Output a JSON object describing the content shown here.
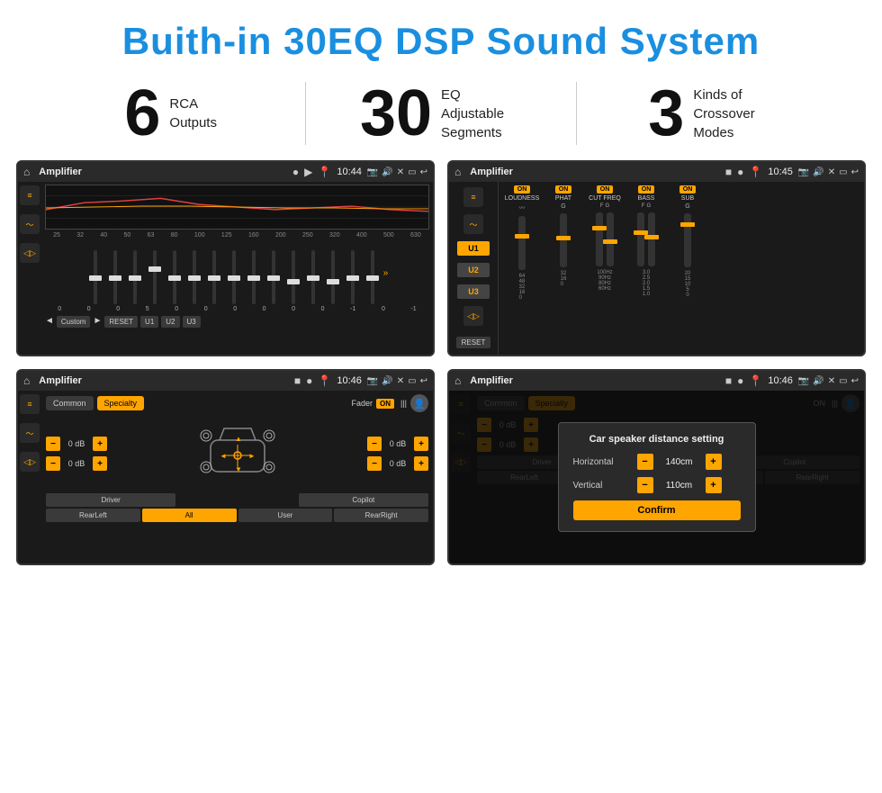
{
  "header": {
    "title": "Buith-in 30EQ DSP Sound System"
  },
  "stats": [
    {
      "number": "6",
      "text": "RCA\nOutputs"
    },
    {
      "number": "30",
      "text": "EQ Adjustable\nSegments"
    },
    {
      "number": "3",
      "text": "Kinds of\nCrossover Modes"
    }
  ],
  "screens": [
    {
      "id": "eq-screen",
      "title": "Amplifier",
      "time": "10:44",
      "type": "eq"
    },
    {
      "id": "amp2-screen",
      "title": "Amplifier",
      "time": "10:45",
      "type": "amp2"
    },
    {
      "id": "fader-screen",
      "title": "Amplifier",
      "time": "10:46",
      "type": "fader"
    },
    {
      "id": "dialog-screen",
      "title": "Amplifier",
      "time": "10:46",
      "type": "dialog"
    }
  ],
  "eq": {
    "freqs": [
      "25",
      "32",
      "40",
      "50",
      "63",
      "80",
      "100",
      "125",
      "160",
      "200",
      "250",
      "320",
      "400",
      "500",
      "630"
    ],
    "values": [
      "0",
      "0",
      "0",
      "5",
      "0",
      "0",
      "0",
      "0",
      "0",
      "0",
      "-1",
      "0",
      "-1"
    ],
    "presets": [
      "Custom",
      "RESET",
      "U1",
      "U2",
      "U3"
    ]
  },
  "amp2": {
    "channels": [
      "LOUDNESS",
      "PHAT",
      "CUT FREQ",
      "BASS",
      "SUB"
    ],
    "u_buttons": [
      "U1",
      "U2",
      "U3"
    ],
    "reset_label": "RESET"
  },
  "fader": {
    "tabs": [
      "Common",
      "Specialty"
    ],
    "fader_label": "Fader",
    "on_label": "ON",
    "db_values": [
      "0 dB",
      "0 dB",
      "0 dB",
      "0 dB"
    ],
    "buttons": [
      "Driver",
      "Copilot",
      "RearLeft",
      "All",
      "User",
      "RearRight"
    ]
  },
  "dialog": {
    "title": "Car speaker distance setting",
    "horizontal_label": "Horizontal",
    "horizontal_value": "140cm",
    "vertical_label": "Vertical",
    "vertical_value": "110cm",
    "confirm_label": "Confirm",
    "tabs": [
      "Common",
      "Specialty"
    ],
    "db_values": [
      "0 dB",
      "0 dB"
    ],
    "buttons": [
      "Driver",
      "Copilot",
      "RearLeft",
      "All",
      "User",
      "RearRight"
    ]
  }
}
